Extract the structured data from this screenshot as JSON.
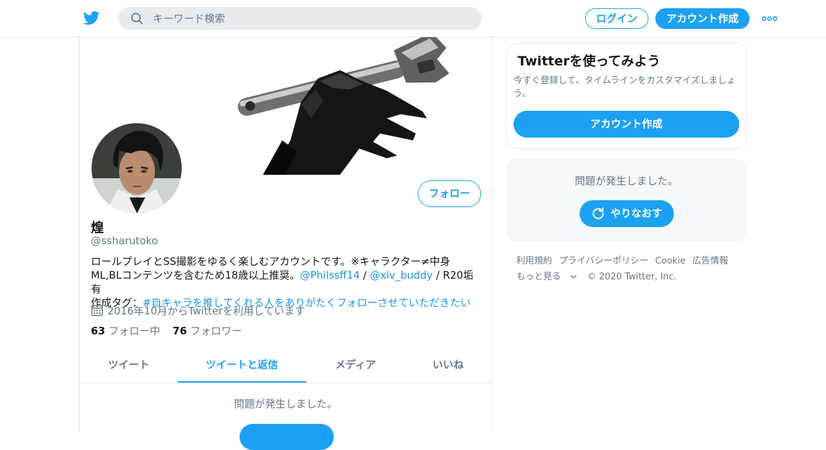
{
  "header": {
    "search_placeholder": "キーワード検索",
    "login_label": "ログイン",
    "signup_label": "アカウント作成",
    "brand_color": "#1da1f2"
  },
  "profile": {
    "name": "煌",
    "handle": "@ssharutoko",
    "follow_label": "フォロー",
    "bio_line1": "ロールプレイとSS撮影をゆるく楽しむアカウントです。※キャラクター≠中身",
    "bio_line2_prefix": "ML,BLコンテンツを含むため18歳以上推奨。",
    "bio_mention1": "@Philssff14",
    "bio_sep1": " / ",
    "bio_mention2": "@xiv_buddy",
    "bio_line2_suffix": " / R20垢有",
    "bio_line3_prefix": "作成タグ：",
    "bio_hashtag": "#自キャラを推してくれる人をありがたくフォローさせていただきたい",
    "joined": "2016年10月からTwitterを利用しています",
    "following_count": "63",
    "following_label": "フォロー中",
    "followers_count": "76",
    "followers_label": "フォロワー"
  },
  "tabs": [
    {
      "label": "ツイート",
      "active": false
    },
    {
      "label": "ツイートと返信",
      "active": true
    },
    {
      "label": "メディア",
      "active": false
    },
    {
      "label": "いいね",
      "active": false
    }
  ],
  "timeline": {
    "error_message": "問題が発生しました。"
  },
  "sidebar": {
    "signup_card": {
      "title": "Twitterを使ってみよう",
      "description": "今すぐ登録して、タイムラインをカスタマイズしましょう。",
      "button_label": "アカウント作成"
    },
    "error_card": {
      "message": "問題が発生しました。",
      "retry_label": "やりなおす"
    },
    "footer": {
      "links": [
        "利用規約",
        "プライバシーポリシー",
        "Cookie",
        "広告情報"
      ],
      "more_label": "もっと見る",
      "copyright": "© 2020 Twitter, Inc."
    }
  }
}
